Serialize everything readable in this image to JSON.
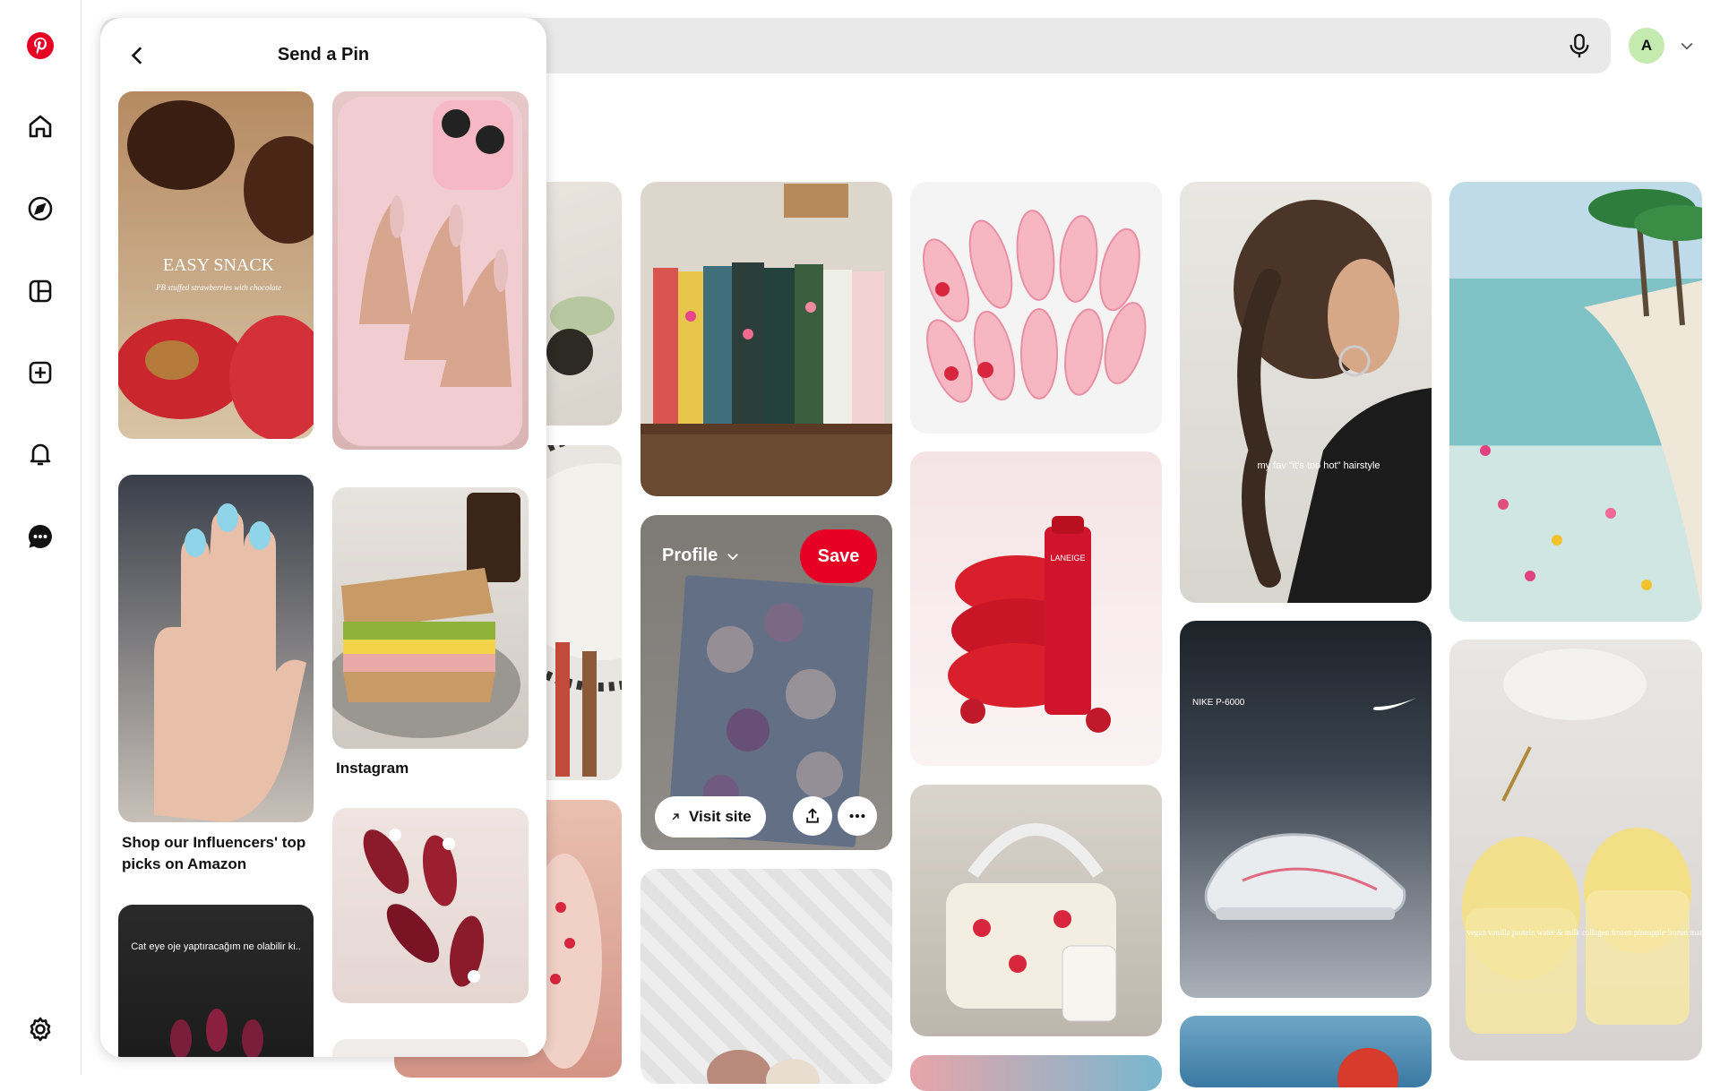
{
  "rail": {
    "items": [
      {
        "name": "pinterest-logo",
        "active": false
      },
      {
        "name": "home",
        "active": false
      },
      {
        "name": "explore",
        "active": false
      },
      {
        "name": "boards",
        "active": false
      },
      {
        "name": "create",
        "active": false
      },
      {
        "name": "notifications",
        "active": false
      },
      {
        "name": "messages",
        "active": true
      },
      {
        "name": "settings",
        "active": false
      }
    ]
  },
  "header": {
    "search_placeholder": "",
    "avatar_initial": "A"
  },
  "colors": {
    "brand": "#e60023",
    "search_bg": "#e9e9e9",
    "avatar_bg": "#c4eab0"
  },
  "panel": {
    "title": "Send a Pin",
    "pins": [
      {
        "overlay_title": "EASY SNACK",
        "overlay_sub": "PB stuffed strawberries with chocolate",
        "caption": ""
      },
      {
        "caption": ""
      },
      {
        "caption": "Shop our Influencers' top picks on Amazon"
      },
      {
        "caption": "Instagram"
      },
      {
        "overlay_text": "Cat eye oje yaptıracağım ne olabilir ki..",
        "caption": ""
      },
      {
        "caption": ""
      }
    ]
  },
  "grid": {
    "hovered_pin": {
      "profile_label": "Profile",
      "save_label": "Save",
      "visit_label": "Visit site"
    },
    "pins": [
      {
        "text": "my fav \"it's too hot\" hairstyle"
      },
      {
        "text": "NIKE P-6000"
      },
      {
        "text": "LANEIGE"
      },
      {
        "text": "vegan vanilla protein water & milk collagen frozen pineapple frozen mango lemon ginger tumeric"
      }
    ]
  }
}
